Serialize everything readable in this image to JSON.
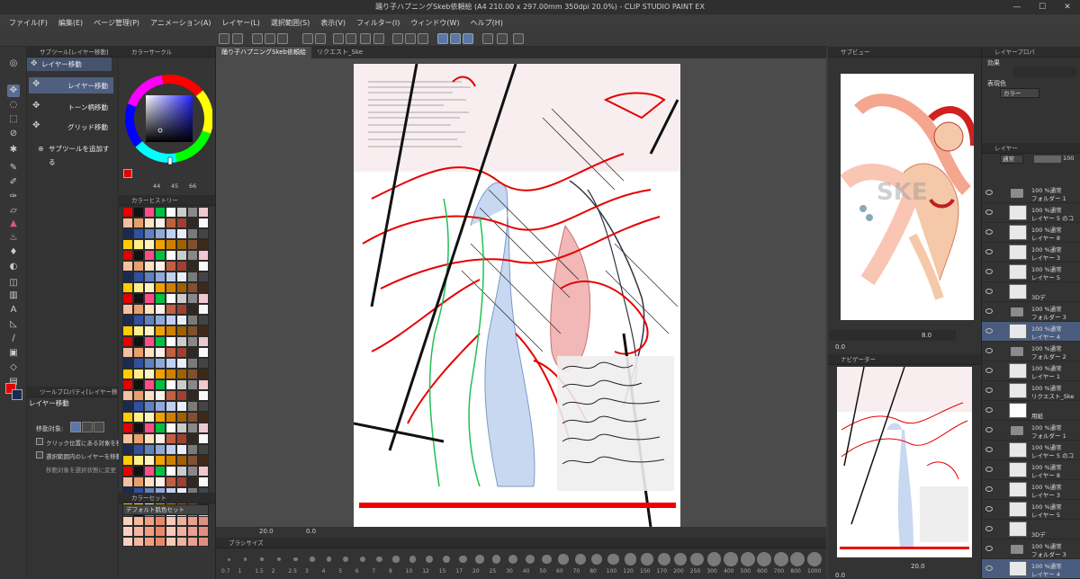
{
  "app": {
    "title": "踊り子ハプニングSkeb依頼絵 (A4 210.00 x 297.00mm 350dpi 20.0%) - CLIP STUDIO PAINT EX",
    "win_min": "—",
    "win_max": "☐",
    "win_close": "✕"
  },
  "menu": [
    "ファイル(F)",
    "編集(E)",
    "ページ管理(P)",
    "アニメーション(A)",
    "レイヤー(L)",
    "選択範囲(S)",
    "表示(V)",
    "フィルター(I)",
    "ウィンドウ(W)",
    "ヘルプ(H)"
  ],
  "subtool": {
    "header": "サブツール[レイヤー移動]",
    "group": "レイヤー移動",
    "items": [
      "レイヤー移動",
      "トーン柄移動",
      "グリッド移動"
    ],
    "add_label": "サブツールを追加する"
  },
  "tool_property": {
    "header": "ツールプロパティ[レイヤー移動]",
    "name": "レイヤー移動",
    "target_label": "移動対象:",
    "options": [
      "クリック位置にある対象を移動",
      "選択範囲内のレイヤーを移動"
    ],
    "note": "移動対象を選択状態に変更"
  },
  "color_circle": {
    "header": "カラーサークル",
    "r": "44",
    "g": "45",
    "b": "66"
  },
  "color_history": {
    "header": "カラーヒストリー"
  },
  "color_set": {
    "header": "カラーセット",
    "selected": "デフォルト肌色セット"
  },
  "doc_tabs": [
    "踊り子ハプニングSkeb依頼絵",
    "リクエスト_Ske"
  ],
  "status": {
    "zoom": "20.0",
    "angle": "0.0"
  },
  "brush_size": {
    "header": "ブラシサイズ",
    "sizes": [
      "0.7",
      "1",
      "1.5",
      "2",
      "2.5",
      "3",
      "4",
      "5",
      "6",
      "7",
      "8",
      "10",
      "12",
      "15",
      "17",
      "20",
      "25",
      "30",
      "40",
      "50",
      "60",
      "70",
      "80",
      "100",
      "120",
      "150",
      "170",
      "200",
      "250",
      "300",
      "400",
      "500",
      "600",
      "700",
      "800",
      "1000"
    ]
  },
  "sub_view": {
    "header": "サブビュー",
    "zoom": "8.0",
    "angle": "0.0"
  },
  "navigator": {
    "header": "ナビゲーター",
    "zoom": "20.0",
    "angle": "0.0"
  },
  "layer_property": {
    "header": "レイヤープロパ",
    "effect_label": "効果",
    "expression_label": "表現色",
    "expression_value": "カラー"
  },
  "layer_panel": {
    "header": "レイヤー",
    "blend": "通常",
    "opacity": "100",
    "layers": [
      {
        "l1": "100 %通常",
        "l2": "フォルダー 1",
        "type": "folder"
      },
      {
        "l1": "100 %通常",
        "l2": "レイヤー 5 のコ",
        "type": "layer"
      },
      {
        "l1": "100 %通常",
        "l2": "レイヤー 8",
        "type": "layer"
      },
      {
        "l1": "100 %通常",
        "l2": "レイヤー 3",
        "type": "layer"
      },
      {
        "l1": "100 %通常",
        "l2": "レイヤー 5",
        "type": "layer"
      },
      {
        "l1": "",
        "l2": "3Dデ",
        "type": "3d"
      },
      {
        "l1": "100 %通常",
        "l2": "フォルダー 3",
        "type": "folder"
      },
      {
        "l1": "100 %通常",
        "l2": "レイヤー 4",
        "type": "layer",
        "sel": true
      },
      {
        "l1": "100 %通常",
        "l2": "フォルダー 2",
        "type": "folder"
      },
      {
        "l1": "100 %通常",
        "l2": "レイヤー 1",
        "type": "layer"
      },
      {
        "l1": "100 %通常",
        "l2": "リクエスト_Ske",
        "type": "layer"
      },
      {
        "l1": "",
        "l2": "用紙",
        "type": "paper"
      },
      {
        "l1": "100 %通常",
        "l2": "フォルダー 1",
        "type": "folder"
      },
      {
        "l1": "100 %通常",
        "l2": "レイヤー 5 のコ",
        "type": "layer"
      },
      {
        "l1": "100 %通常",
        "l2": "レイヤー 8",
        "type": "layer"
      },
      {
        "l1": "100 %通常",
        "l2": "レイヤー 3",
        "type": "layer"
      },
      {
        "l1": "100 %通常",
        "l2": "レイヤー 5",
        "type": "layer"
      },
      {
        "l1": "",
        "l2": "3Dデ",
        "type": "3d"
      },
      {
        "l1": "100 %通常",
        "l2": "フォルダー 3",
        "type": "folder"
      },
      {
        "l1": "100 %通常",
        "l2": "レイヤー 4",
        "type": "layer",
        "sel": true
      }
    ]
  },
  "colors": {
    "accent": "#5a77a8",
    "main_color": "#e60000",
    "sub_color": "#1a2a55"
  }
}
